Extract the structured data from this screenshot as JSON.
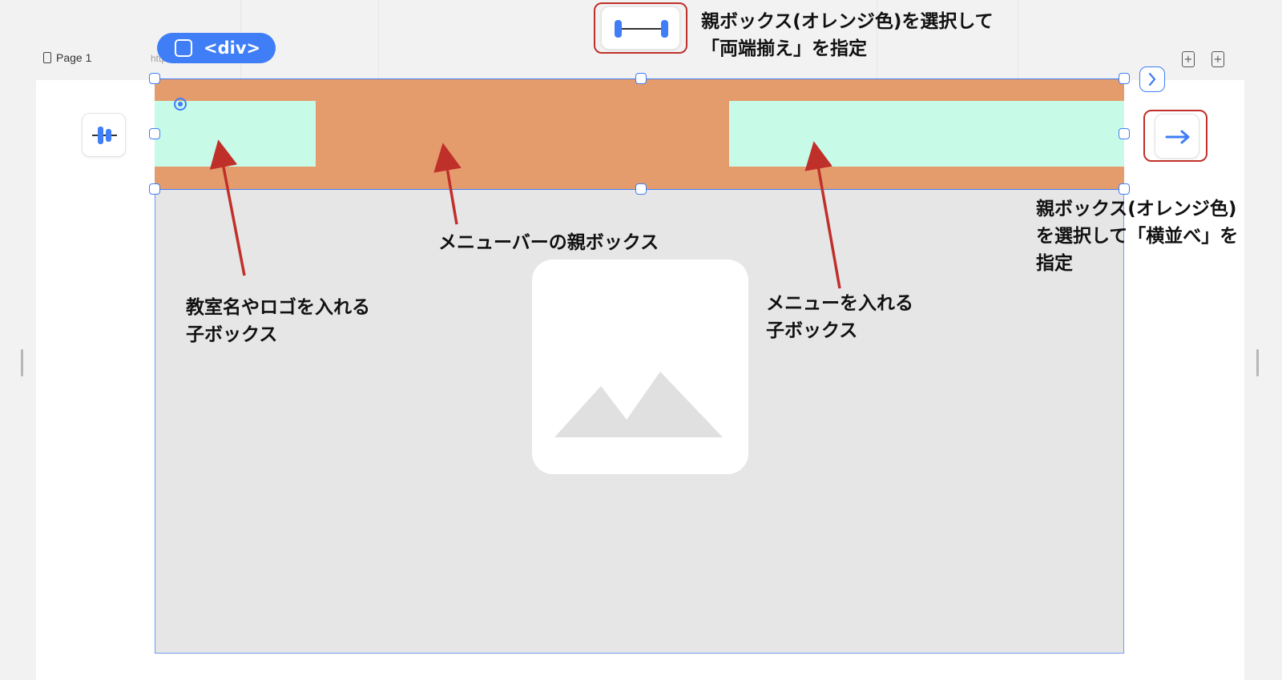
{
  "header": {
    "page_label": "Page 1",
    "url": "https://mediframe.site/1",
    "element_tag": "<div>",
    "add_icon_glyph": "+"
  },
  "annotations": {
    "justify": "親ボックス(オレンジ色)を選択して\n「両端揃え」を指定",
    "horizontal": "親ボックス(オレンジ色)\nを選択して「横並べ」を\n指定",
    "parent_box": "メニューバーの親ボックス",
    "logo_child": "教室名やロゴを入れる\n子ボックス",
    "menu_child": "メニューを入れる\n子ボックス"
  },
  "icons": {
    "page": "document-icon",
    "chip": "square-icon",
    "justify": "justify-space-between-icon",
    "direction": "arrow-right-icon",
    "align": "align-center-icon",
    "next": "chevron-right-icon",
    "image": "image-placeholder-icon"
  },
  "colors": {
    "accent": "#3f7ef7",
    "parent_box": "#e59c6c",
    "child_box": "#c8fae8",
    "highlight": "#c0302a",
    "arrow": "#c0302a"
  }
}
